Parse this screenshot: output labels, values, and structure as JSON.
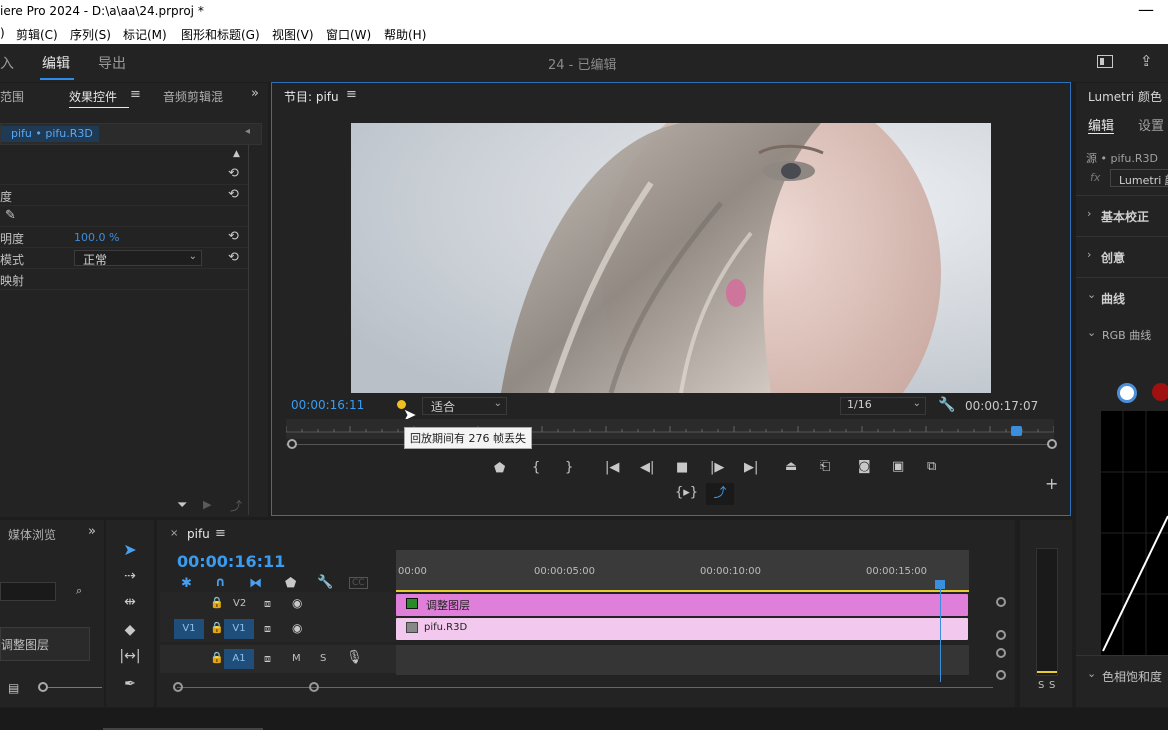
{
  "window": {
    "title": "iere Pro 2024 - D:\\a\\aa\\24.prproj *",
    "minimize": "—"
  },
  "menu": [
    {
      "label": ")"
    },
    {
      "label": "剪辑(C)"
    },
    {
      "label": "序列(S)"
    },
    {
      "label": "标记(M)"
    },
    {
      "label": "图形和标题(G)"
    },
    {
      "label": "视图(V)"
    },
    {
      "label": "窗口(W)"
    },
    {
      "label": "帮助(H)"
    }
  ],
  "workspace": {
    "tabs": [
      "入",
      "编辑",
      "导出"
    ],
    "active": "编辑",
    "project_title": "24 - 已编辑"
  },
  "effects_panel": {
    "tabs": [
      "范围",
      "效果控件",
      "音频剪辑混"
    ],
    "active": "效果控件",
    "clip_label": "pifu • pifu.R3D",
    "properties": [
      {
        "label": "",
        "value": ""
      },
      {
        "label": "度",
        "value": ""
      },
      {
        "label": "",
        "value": ""
      },
      {
        "label": "明度",
        "value": "100.0 %"
      },
      {
        "label": "模式",
        "value": "正常"
      },
      {
        "label": "映射",
        "value": ""
      }
    ],
    "blend_mode": "正常"
  },
  "program_monitor": {
    "title": "节目: pifu",
    "timecode_current": "00:00:16:11",
    "timecode_duration": "00:00:17:07",
    "fit": "适合",
    "resolution": "1/16",
    "tooltip": "回放期间有 276 帧丢失",
    "dropped_frames_indicator_color": "#f0c020",
    "playhead_fraction": 0.95
  },
  "media_panel": {
    "tabs": [
      "媒体浏览"
    ],
    "item": "调整图层"
  },
  "timeline": {
    "sequence_name": "pifu",
    "timecode": "00:00:16:11",
    "ruler": [
      "00:00",
      "00:00:05:00",
      "00:00:10:00",
      "00:00:15:00"
    ],
    "tracks": [
      {
        "id": "V2",
        "target": "",
        "clip": "调整图层",
        "color": "#e07fd9"
      },
      {
        "id": "V1",
        "target": "V1",
        "clip": "pifu.R3D",
        "color": "#f3c8ee"
      },
      {
        "id": "A1",
        "target": "A1",
        "clip": "",
        "color": ""
      }
    ],
    "audio_labels": {
      "mute": "M",
      "solo": "S"
    },
    "playhead_fraction": 0.95
  },
  "lumetri": {
    "title": "Lumetri 颜色",
    "tabs": [
      "编辑",
      "设置"
    ],
    "source": "源 • pifu.R3D",
    "effect": "Lumetri 颜",
    "sections": [
      "基本校正",
      "创意",
      "曲线"
    ],
    "subsection": "RGB 曲线",
    "bottom_section": "色相饱和度"
  },
  "meter": {
    "labels": [
      "S",
      "S"
    ]
  }
}
